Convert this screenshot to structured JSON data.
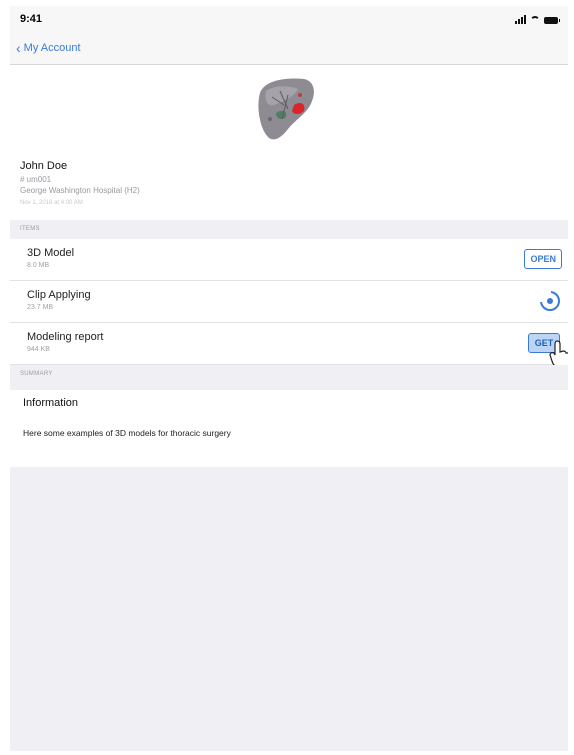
{
  "status_bar": {
    "time": "9:41"
  },
  "nav": {
    "back_label": "My Account"
  },
  "patient": {
    "name": "John Doe",
    "id_line": "# um001",
    "hospital_line": "George Washington Hospital (H2)",
    "date_line": "Nov 1, 2018 at 4:00 AM"
  },
  "items_section": {
    "header": "ITEMS",
    "rows": [
      {
        "title": "3D Model",
        "size": "8.0 MB",
        "action": "OPEN"
      },
      {
        "title": "Clip Applying",
        "size": "23.7 MB",
        "action": "progress"
      },
      {
        "title": "Modeling report",
        "size": "944 KB",
        "action": "GET"
      }
    ]
  },
  "summary_section": {
    "header": "SUMMARY",
    "title": "Information",
    "text": "Here some examples of 3D models for thoracic surgery"
  },
  "colors": {
    "accent": "#3a7bd5",
    "background": "#efeff4"
  },
  "icons": [
    "chevron-left-icon",
    "signal-icon",
    "wifi-icon",
    "battery-icon",
    "download-progress-icon",
    "pointer-cursor-icon"
  ]
}
